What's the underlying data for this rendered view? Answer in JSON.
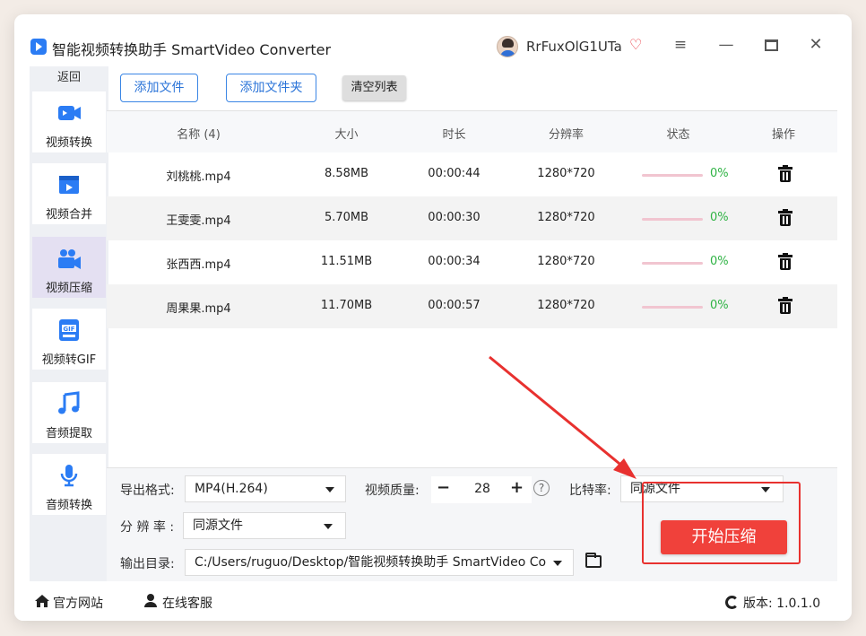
{
  "app": {
    "title": "智能视频转换助手 SmartVideo Converter",
    "user_name": "RrFuxOlG1UTa"
  },
  "sidebar": {
    "back_label": "返回",
    "items": [
      {
        "label": "视频转换",
        "icon": "video-convert-icon"
      },
      {
        "label": "视频合并",
        "icon": "video-merge-icon"
      },
      {
        "label": "视频压缩",
        "icon": "video-compress-icon",
        "active": true
      },
      {
        "label": "视频转GIF",
        "icon": "gif-icon"
      },
      {
        "label": "音频提取",
        "icon": "music-note-icon"
      },
      {
        "label": "音频转换",
        "icon": "microphone-icon"
      }
    ]
  },
  "toolbar": {
    "add_file": "添加文件",
    "add_folder": "添加文件夹",
    "clear_list": "清空列表"
  },
  "table": {
    "headers": [
      "名称 (4)",
      "大小",
      "时长",
      "分辨率",
      "状态",
      "操作"
    ],
    "rows": [
      {
        "name": "刘桃桃.mp4",
        "size": "8.58MB",
        "duration": "00:00:44",
        "resolution": "1280*720",
        "progress": "0%"
      },
      {
        "name": "王雯雯.mp4",
        "size": "5.70MB",
        "duration": "00:00:30",
        "resolution": "1280*720",
        "progress": "0%"
      },
      {
        "name": "张西西.mp4",
        "size": "11.51MB",
        "duration": "00:00:34",
        "resolution": "1280*720",
        "progress": "0%"
      },
      {
        "name": "周果果.mp4",
        "size": "11.70MB",
        "duration": "00:00:57",
        "resolution": "1280*720",
        "progress": "0%"
      }
    ]
  },
  "settings": {
    "format_label": "导出格式:",
    "format_value": "MP4(H.264)",
    "quality_label": "视频质量:",
    "quality_value": "28",
    "quality_minus": "−",
    "quality_plus": "+",
    "bitrate_label": "比特率:",
    "bitrate_value": "同源文件",
    "resolution_label": "分 辨 率 :",
    "resolution_value": "同源文件",
    "output_label": "输出目录:",
    "output_value": "C:/Users/ruguo/Desktop/智能视频转换助手 SmartVideo Co",
    "start_button": "开始压缩"
  },
  "footer": {
    "website": "官方网站",
    "support": "在线客服",
    "version": "版本: 1.0.1.0"
  },
  "colors": {
    "accent": "#3b86e5",
    "start_button": "#f0413b",
    "annotation_red": "#e8312f",
    "progress_text": "#2fb344"
  }
}
